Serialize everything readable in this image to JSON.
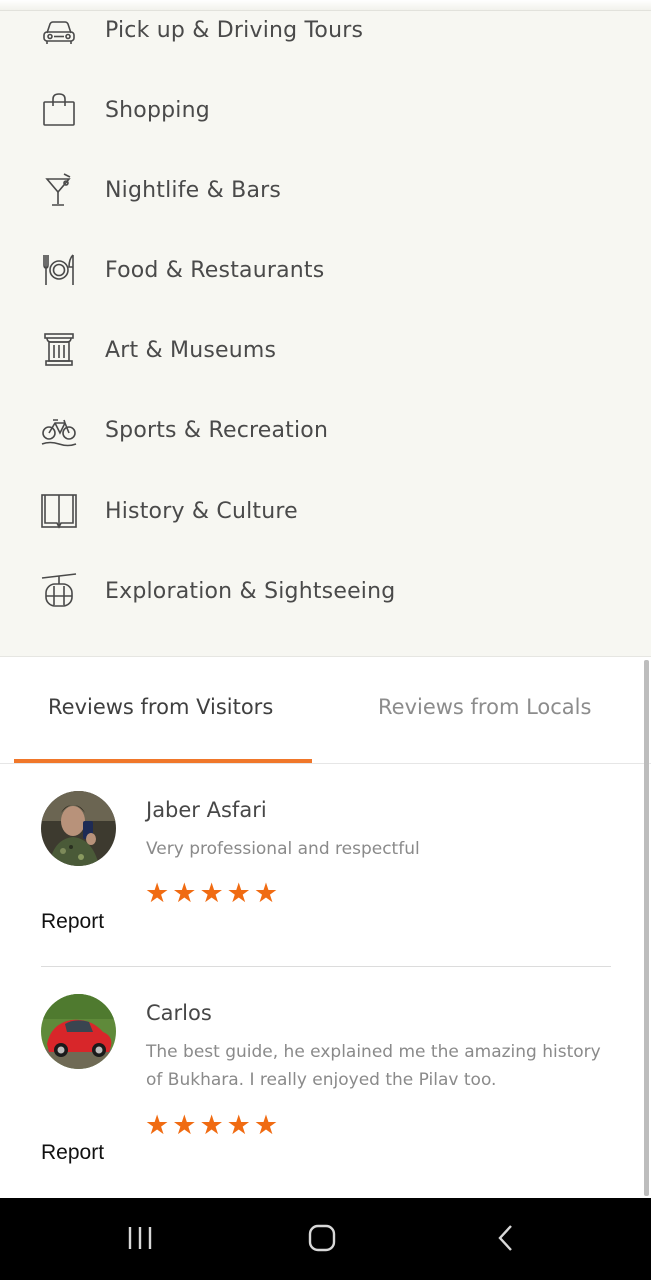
{
  "categories": [
    {
      "label": "Pick up & Driving Tours",
      "icon": "car-icon"
    },
    {
      "label": "Shopping",
      "icon": "shopping-bag-icon"
    },
    {
      "label": "Nightlife & Bars",
      "icon": "cocktail-icon"
    },
    {
      "label": "Food & Restaurants",
      "icon": "plate-cutlery-icon"
    },
    {
      "label": "Art & Museums",
      "icon": "column-icon"
    },
    {
      "label": "Sports & Recreation",
      "icon": "bicycle-icon"
    },
    {
      "label": "History & Culture",
      "icon": "book-icon"
    },
    {
      "label": "Exploration & Sightseeing",
      "icon": "cable-car-icon"
    }
  ],
  "tabs": {
    "visitors": "Reviews from Visitors",
    "locals": "Reviews from Locals",
    "active": "visitors"
  },
  "reviews": [
    {
      "name": "Jaber Asfari",
      "text": "Very professional and respectful",
      "rating": 5,
      "report": "Report"
    },
    {
      "name": "Carlos",
      "text": "The best guide, he explained me the amazing history of Bukhara. I really enjoyed the Pilav too.",
      "rating": 5,
      "report": "Report"
    }
  ],
  "colors": {
    "accent": "#f0772a",
    "star": "#f06b12"
  },
  "navbar": {
    "recents": "recents-icon",
    "home": "home-icon",
    "back": "back-icon"
  }
}
